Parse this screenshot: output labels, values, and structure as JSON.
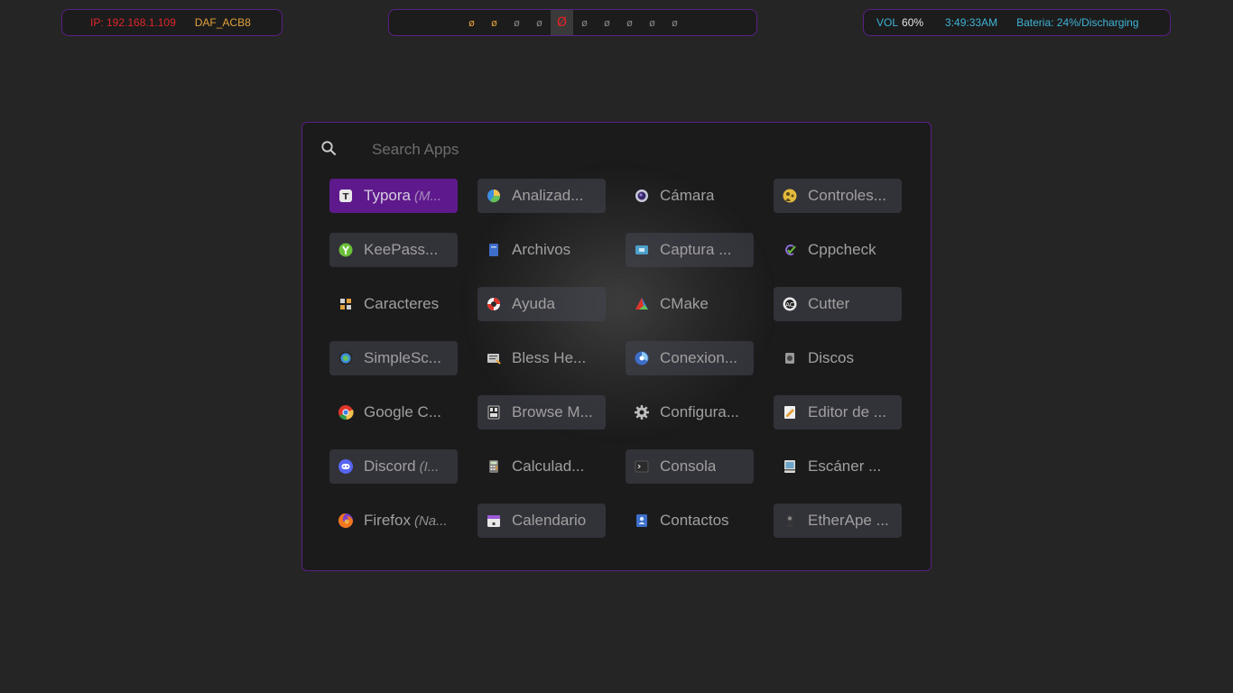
{
  "topbar": {
    "ip": "IP: 192.168.1.109",
    "wifi": "DAF_ACB8",
    "volume_label": "VOL",
    "volume_value": "60%",
    "clock": "3:49:33AM",
    "battery": "Bateria: 24%/Discharging"
  },
  "workspaces": [
    {
      "glyph": "ø",
      "state": "occupied"
    },
    {
      "glyph": "ø",
      "state": "occupied"
    },
    {
      "glyph": "ø",
      "state": "empty"
    },
    {
      "glyph": "ø",
      "state": "empty"
    },
    {
      "glyph": "Ø",
      "state": "active"
    },
    {
      "glyph": "ø",
      "state": "empty"
    },
    {
      "glyph": "ø",
      "state": "empty"
    },
    {
      "glyph": "ø",
      "state": "empty"
    },
    {
      "glyph": "ø",
      "state": "empty"
    },
    {
      "glyph": "ø",
      "state": "empty"
    }
  ],
  "launcher": {
    "search_placeholder": "Search Apps",
    "apps": [
      {
        "name": "Typora",
        "note": "(M...",
        "icon": "typora-icon",
        "style": "selected"
      },
      {
        "name": "Analizad...",
        "note": "",
        "icon": "disk-usage-icon",
        "style": "plate"
      },
      {
        "name": "Cámara",
        "note": "",
        "icon": "camera-icon",
        "style": "plain"
      },
      {
        "name": "Controles...",
        "note": "",
        "icon": "parental-controls-icon",
        "style": "plate"
      },
      {
        "name": "KeePass...",
        "note": "",
        "icon": "keepass-icon",
        "style": "plate"
      },
      {
        "name": "Archivos",
        "note": "",
        "icon": "files-icon",
        "style": "plain"
      },
      {
        "name": "Captura ...",
        "note": "",
        "icon": "screenshot-icon",
        "style": "plate"
      },
      {
        "name": "Cppcheck",
        "note": "",
        "icon": "cppcheck-icon",
        "style": "plain"
      },
      {
        "name": "Caracteres",
        "note": "",
        "icon": "characters-icon",
        "style": "plain"
      },
      {
        "name": "Ayuda",
        "note": "",
        "icon": "help-lifebuoy-icon",
        "style": "plate"
      },
      {
        "name": "CMake",
        "note": "",
        "icon": "cmake-icon",
        "style": "plain"
      },
      {
        "name": "Cutter",
        "note": "",
        "icon": "cutter-icon",
        "style": "plate"
      },
      {
        "name": "SimpleSc...",
        "note": "",
        "icon": "simplescreenrecorder-icon",
        "style": "plate"
      },
      {
        "name": "Bless He...",
        "note": "",
        "icon": "hex-editor-icon",
        "style": "plain"
      },
      {
        "name": "Conexion...",
        "note": "",
        "icon": "connections-icon",
        "style": "plate"
      },
      {
        "name": "Discos",
        "note": "",
        "icon": "disks-icon",
        "style": "plain"
      },
      {
        "name": "Google C...",
        "note": "",
        "icon": "chrome-icon",
        "style": "plain"
      },
      {
        "name": "Browse M...",
        "note": "",
        "icon": "browse-media-icon",
        "style": "plate"
      },
      {
        "name": "Configura...",
        "note": "",
        "icon": "settings-gear-icon",
        "style": "plain"
      },
      {
        "name": "Editor de ...",
        "note": "",
        "icon": "text-editor-icon",
        "style": "plate"
      },
      {
        "name": "Discord",
        "note": "(I...",
        "icon": "discord-icon",
        "style": "plate"
      },
      {
        "name": "Calculad...",
        "note": "",
        "icon": "calculator-icon",
        "style": "plain"
      },
      {
        "name": "Consola",
        "note": "",
        "icon": "terminal-icon",
        "style": "plate"
      },
      {
        "name": "Escáner ...",
        "note": "",
        "icon": "scanner-icon",
        "style": "plain"
      },
      {
        "name": "Firefox",
        "note": "(Na...",
        "icon": "firefox-icon",
        "style": "plain"
      },
      {
        "name": "Calendario",
        "note": "",
        "icon": "calendar-icon",
        "style": "plate"
      },
      {
        "name": "Contactos",
        "note": "",
        "icon": "contacts-icon",
        "style": "plain"
      },
      {
        "name": "EtherApe ...",
        "note": "",
        "icon": "etherape-icon",
        "style": "plate"
      }
    ]
  },
  "colors": {
    "accent_border": "#5b1f86",
    "selected_item": "#5e1a8c",
    "ip_red": "#e0262a",
    "wifi_orange": "#e3a23c",
    "info_cyan": "#3fb4d6"
  }
}
